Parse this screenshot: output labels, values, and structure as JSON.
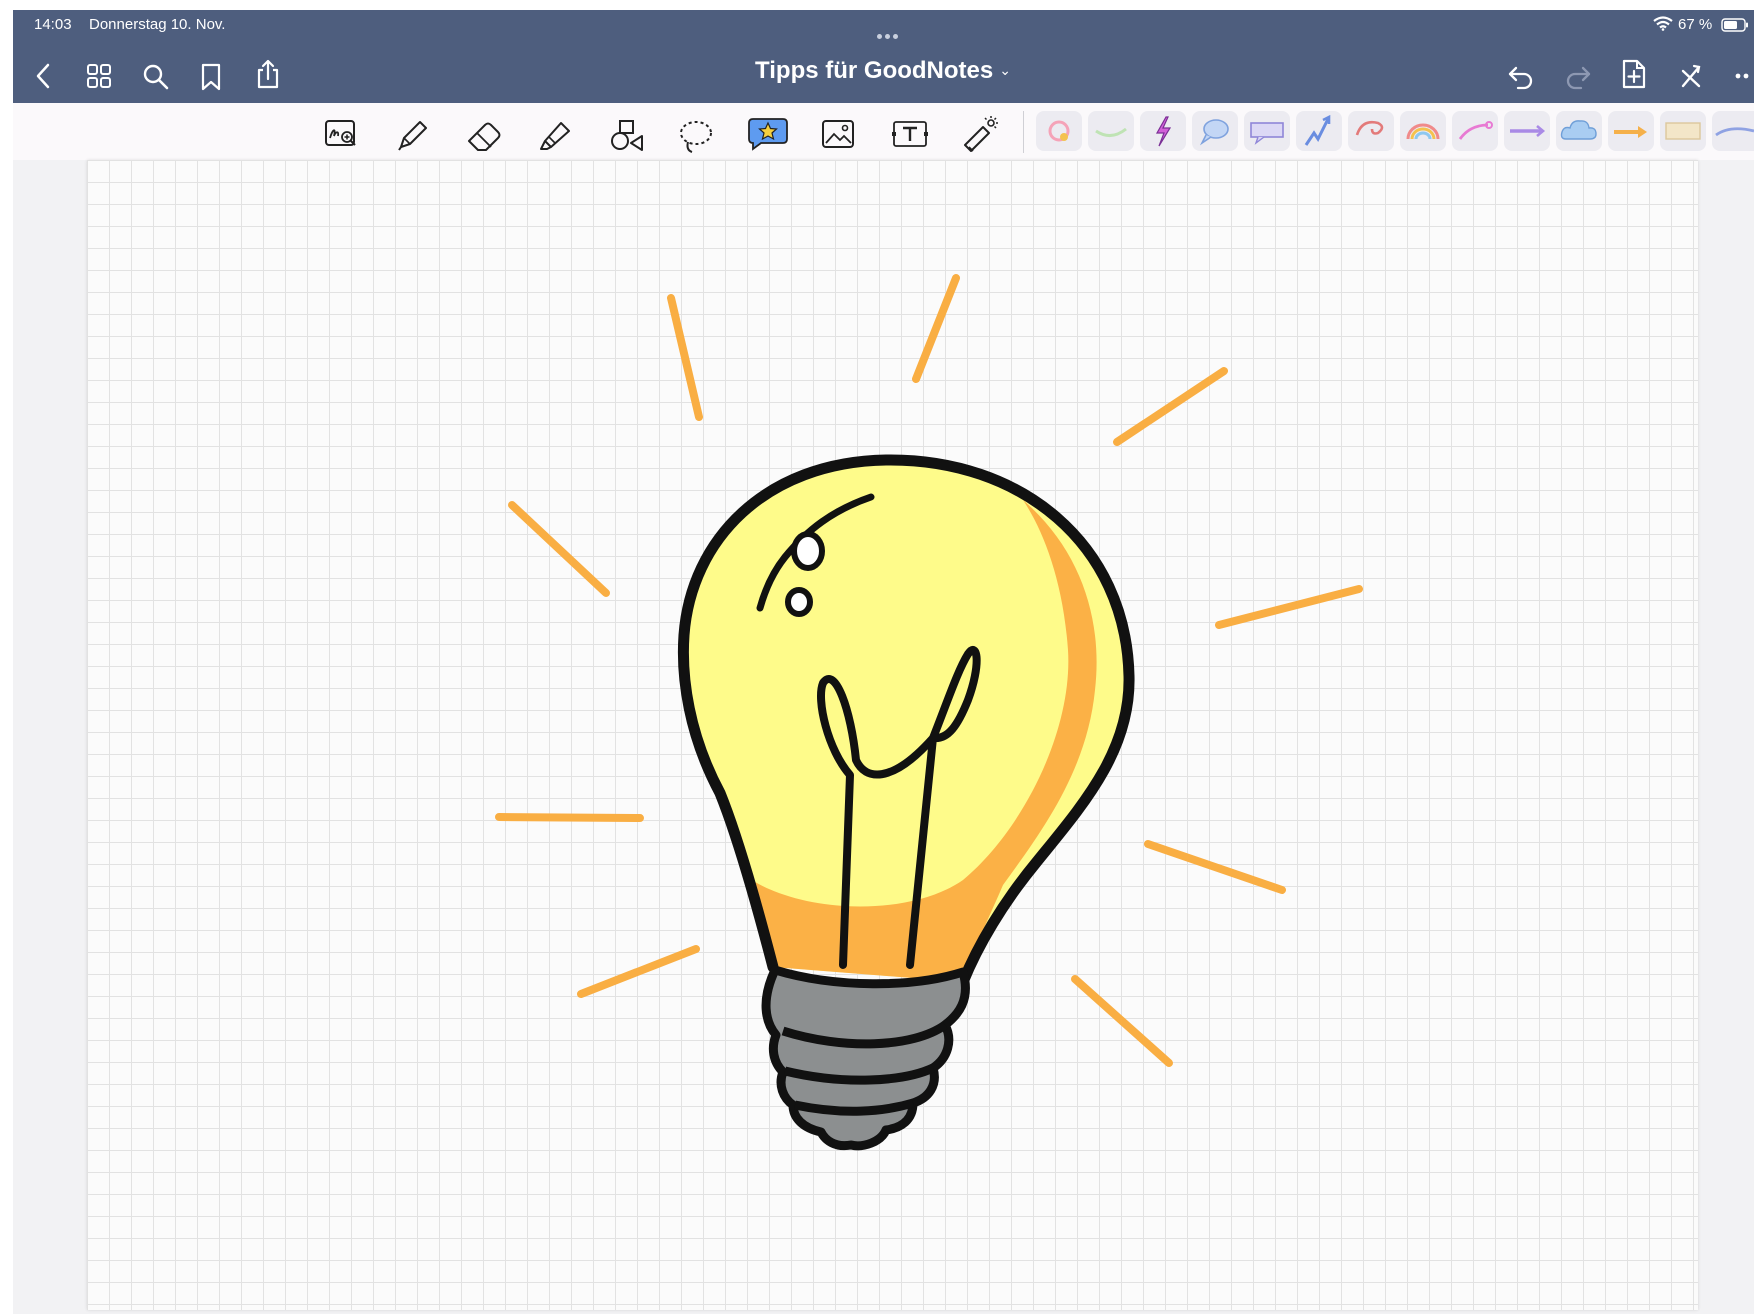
{
  "status_bar": {
    "time": "14:03",
    "date": "Donnerstag 10. Nov.",
    "battery": "67 %"
  },
  "nav": {
    "title": "Tipps für GoodNotes",
    "left_icons": [
      "back-chevron-icon",
      "grid-view-icon",
      "search-icon",
      "bookmark-icon",
      "share-icon"
    ],
    "right_icons": [
      "undo-icon",
      "redo-icon",
      "add-page-icon",
      "close-icon",
      "more-icon"
    ]
  },
  "toolbar": {
    "tools": [
      "zoom-window",
      "pen",
      "eraser",
      "highlighter",
      "shapes",
      "lasso",
      "elements-sticker",
      "image",
      "text",
      "laser-pointer"
    ],
    "active_tool": "elements-sticker",
    "element_colors": [
      "#f7a7b5",
      "#cfe8c6",
      "#c44fd6",
      "#9ab7e8",
      "#9a8fd9",
      "#6a8de0",
      "#e67b7b",
      "#f2b04a",
      "#e87ad3",
      "#a98ae6",
      "#9cc3ef",
      "#f5b04a",
      "#eed6a6",
      "#8fa2e3"
    ]
  },
  "canvas": {
    "background": "grid",
    "bulb_fill": "#fefb8a",
    "bulb_shade": "#fbb146",
    "base_fill": "#8c8f90",
    "rays_color": "#f9ae43"
  }
}
